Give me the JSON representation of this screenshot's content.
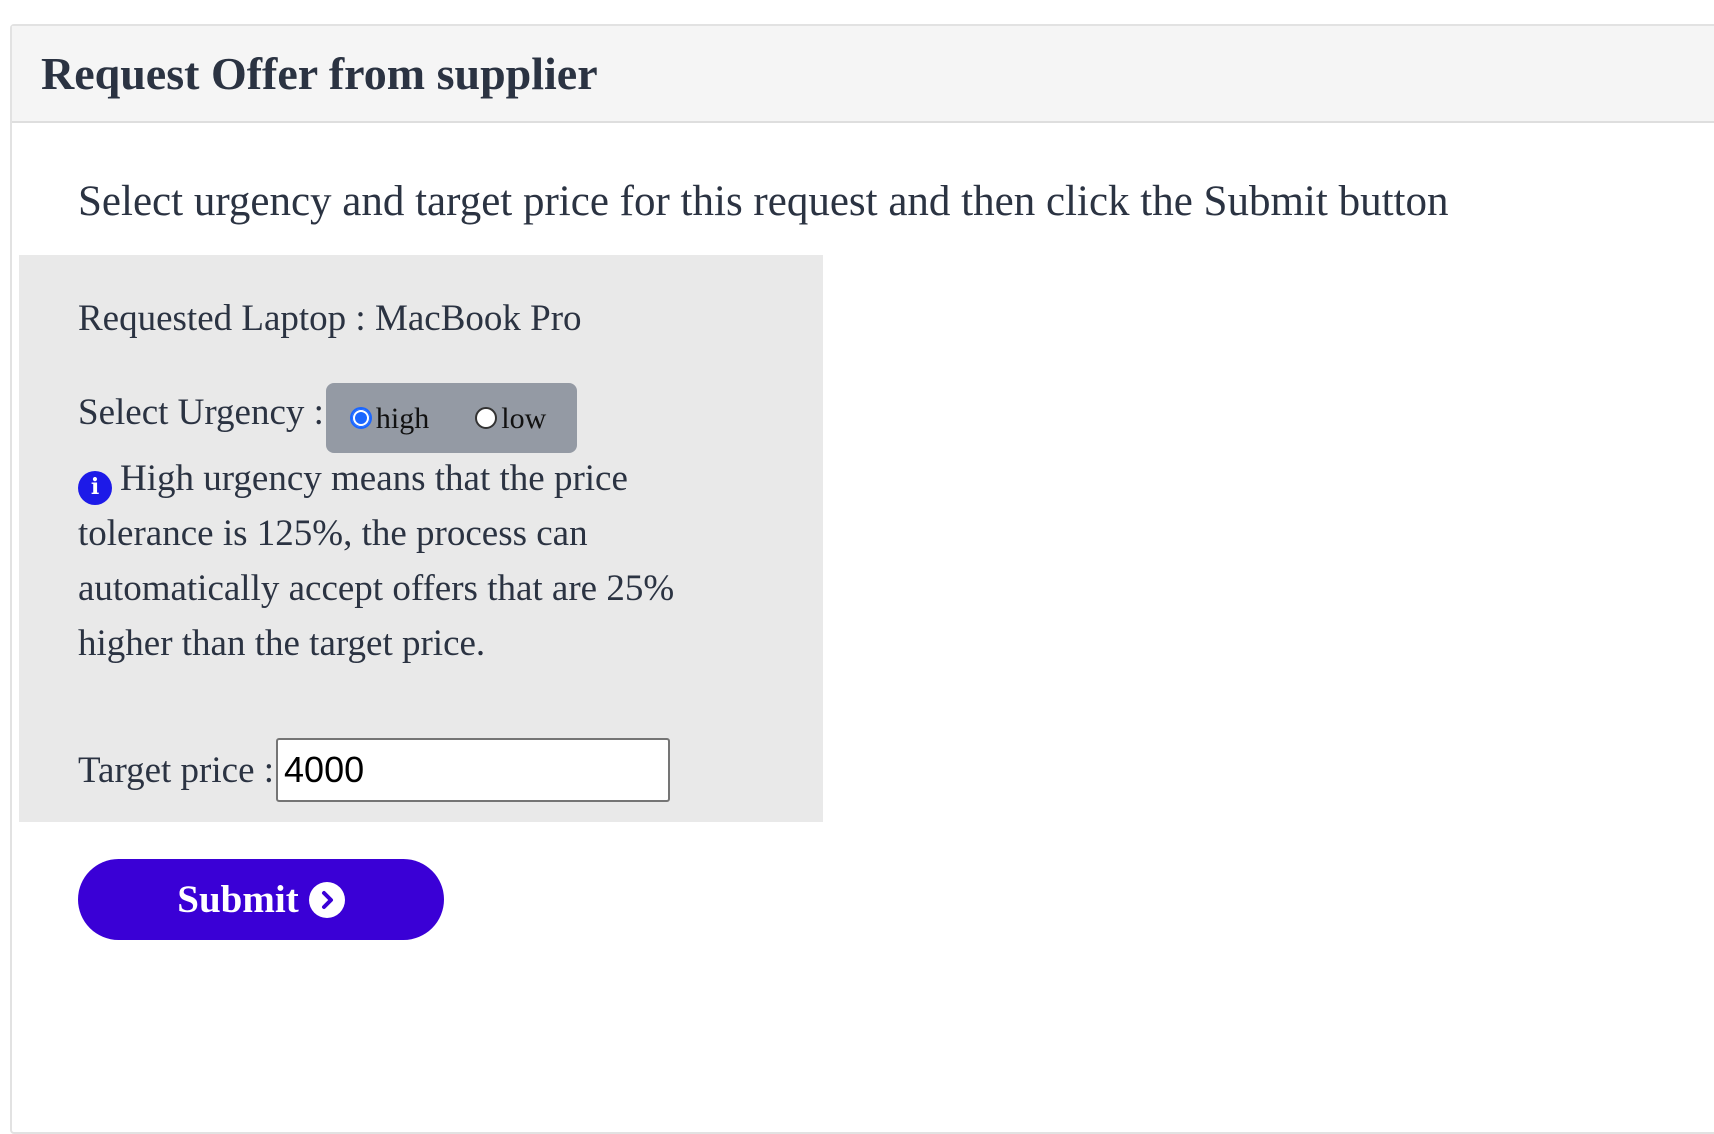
{
  "header": {
    "title": "Request Offer from supplier"
  },
  "instructions": "Select urgency and target price for this request and then click the Submit button",
  "form": {
    "laptop_label": "Requested Laptop : MacBook Pro",
    "urgency_label": "Select Urgency :",
    "urgency_options": [
      {
        "label": "high",
        "selected": true
      },
      {
        "label": "low",
        "selected": false
      }
    ],
    "info_text": "High urgency means that the price tolerance is 125%, the process can automatically accept offers that are 25% higher than the target price.",
    "target_price_label": "Target price :",
    "target_price_value": "4000"
  },
  "submit": {
    "label": "Submit",
    "icon": "chevron-right-circle-icon"
  },
  "colors": {
    "accent": "#3a00d6",
    "radio_group_bg": "#949aa4",
    "panel_bg": "#e9e9e9",
    "info_icon": "#1d1ae8"
  }
}
